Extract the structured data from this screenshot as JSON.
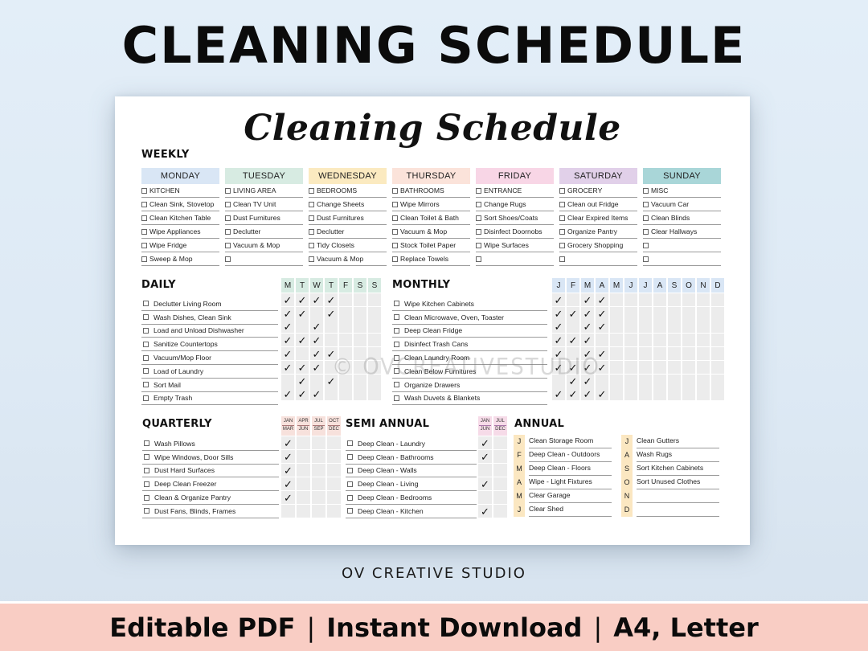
{
  "banner": {
    "title": "CLEANING SCHEDULE"
  },
  "sheet": {
    "title": "Cleaning Schedule",
    "watermark": "© OVCREATIVESTUDIO",
    "weekly": {
      "heading": "WEEKLY",
      "days": [
        {
          "name": "MONDAY",
          "color": "#d9e6f5",
          "tasks": [
            "KITCHEN",
            "Clean Sink, Stovetop",
            "Clean Kitchen Table",
            "Wipe Appliances",
            "Wipe Fridge",
            "Sweep & Mop"
          ]
        },
        {
          "name": "TUESDAY",
          "color": "#d7ebe2",
          "tasks": [
            "LIVING AREA",
            "Clean TV Unit",
            "Dust Furnitures",
            "Declutter",
            "Vacuum & Mop",
            ""
          ]
        },
        {
          "name": "WEDNESDAY",
          "color": "#fbeac0",
          "tasks": [
            "BEDROOMS",
            "Change Sheets",
            "Dust Furnitures",
            "Declutter",
            "Tidy Closets",
            "Vacuum & Mop"
          ]
        },
        {
          "name": "THURSDAY",
          "color": "#fbe3da",
          "tasks": [
            "BATHROOMS",
            "Wipe Mirrors",
            "Clean Toilet & Bath",
            "Vacuum & Mop",
            "Stock Toilet Paper",
            "Replace Towels"
          ]
        },
        {
          "name": "FRIDAY",
          "color": "#f8d6e6",
          "tasks": [
            "ENTRANCE",
            "Change Rugs",
            "Sort Shoes/Coats",
            "Disinfect Doornobs",
            "Wipe Surfaces",
            ""
          ]
        },
        {
          "name": "SATURDAY",
          "color": "#e1d0e9",
          "tasks": [
            "GROCERY",
            "Clean out Fridge",
            "Clear Expired Items",
            "Organize Pantry",
            "Grocery Shopping",
            ""
          ]
        },
        {
          "name": "SUNDAY",
          "color": "#a9d6d8",
          "tasks": [
            "MISC",
            "Vacuum Car",
            "Clean Blinds",
            "Clear Hallways",
            "",
            ""
          ]
        }
      ]
    },
    "daily": {
      "heading": "DAILY",
      "header_color": "#d7ebe2",
      "columns": [
        "M",
        "T",
        "W",
        "T",
        "F",
        "S",
        "S"
      ],
      "check_glyph": "✓",
      "tasks": [
        {
          "label": "Declutter Living Room",
          "checks": [
            1,
            1,
            1,
            1,
            0,
            0,
            0
          ]
        },
        {
          "label": "Wash Dishes, Clean Sink",
          "checks": [
            1,
            1,
            0,
            1,
            0,
            0,
            0
          ]
        },
        {
          "label": "Load and Unload Dishwasher",
          "checks": [
            1,
            0,
            1,
            0,
            0,
            0,
            0
          ]
        },
        {
          "label": "Sanitize Countertops",
          "checks": [
            1,
            1,
            1,
            0,
            0,
            0,
            0
          ]
        },
        {
          "label": "Vacuum/Mop Floor",
          "checks": [
            1,
            0,
            1,
            1,
            0,
            0,
            0
          ]
        },
        {
          "label": "Load of Laundry",
          "checks": [
            1,
            1,
            1,
            0,
            0,
            0,
            0
          ]
        },
        {
          "label": "Sort Mail",
          "checks": [
            0,
            1,
            0,
            1,
            0,
            0,
            0
          ]
        },
        {
          "label": "Empty Trash",
          "checks": [
            1,
            1,
            1,
            0,
            0,
            0,
            0
          ]
        }
      ]
    },
    "monthly": {
      "heading": "MONTHLY",
      "header_color": "#d9e6f5",
      "columns": [
        "J",
        "F",
        "M",
        "A",
        "M",
        "J",
        "J",
        "A",
        "S",
        "O",
        "N",
        "D"
      ],
      "check_glyph": "✓",
      "tasks": [
        {
          "label": "Wipe Kitchen Cabinets",
          "checks": [
            1,
            0,
            1,
            1,
            0,
            0,
            0,
            0,
            0,
            0,
            0,
            0
          ]
        },
        {
          "label": "Clean Microwave, Oven, Toaster",
          "checks": [
            1,
            1,
            1,
            1,
            0,
            0,
            0,
            0,
            0,
            0,
            0,
            0
          ]
        },
        {
          "label": "Deep Clean Fridge",
          "checks": [
            1,
            0,
            1,
            1,
            0,
            0,
            0,
            0,
            0,
            0,
            0,
            0
          ]
        },
        {
          "label": "Disinfect Trash Cans",
          "checks": [
            1,
            1,
            1,
            0,
            0,
            0,
            0,
            0,
            0,
            0,
            0,
            0
          ]
        },
        {
          "label": "Clean Laundry Room",
          "checks": [
            1,
            0,
            1,
            1,
            0,
            0,
            0,
            0,
            0,
            0,
            0,
            0
          ]
        },
        {
          "label": "Clean Below Furnitures",
          "checks": [
            1,
            1,
            1,
            1,
            0,
            0,
            0,
            0,
            0,
            0,
            0,
            0
          ]
        },
        {
          "label": "Organize Drawers",
          "checks": [
            0,
            1,
            1,
            0,
            0,
            0,
            0,
            0,
            0,
            0,
            0,
            0
          ]
        },
        {
          "label": "Wash Duvets & Blankets",
          "checks": [
            1,
            1,
            1,
            1,
            0,
            0,
            0,
            0,
            0,
            0,
            0,
            0
          ]
        }
      ]
    },
    "quarterly": {
      "heading": "QUARTERLY",
      "columns": [
        {
          "top": "JAN",
          "bottom": "MAR"
        },
        {
          "top": "APR",
          "bottom": "JUN"
        },
        {
          "top": "JUL",
          "bottom": "SEP"
        },
        {
          "top": "OCT",
          "bottom": "DEC"
        }
      ],
      "check_glyph": "✓",
      "tasks": [
        {
          "label": "Wash Pillows",
          "checks": [
            1,
            0,
            0,
            0
          ]
        },
        {
          "label": "Wipe Windows, Door Sills",
          "checks": [
            1,
            0,
            0,
            0
          ]
        },
        {
          "label": "Dust Hard Surfaces",
          "checks": [
            1,
            0,
            0,
            0
          ]
        },
        {
          "label": "Deep Clean Freezer",
          "checks": [
            1,
            0,
            0,
            0
          ]
        },
        {
          "label": "Clean & Organize Pantry",
          "checks": [
            1,
            0,
            0,
            0
          ]
        },
        {
          "label": "Dust Fans, Blinds, Frames",
          "checks": [
            0,
            0,
            0,
            0
          ]
        }
      ]
    },
    "semi_annual": {
      "heading": "SEMI ANNUAL",
      "columns": [
        {
          "top": "JAN",
          "bottom": "JUN"
        },
        {
          "top": "JUL",
          "bottom": "DEC"
        }
      ],
      "check_glyph": "✓",
      "tasks": [
        {
          "label": "Deep Clean - Laundry",
          "checks": [
            1,
            0
          ]
        },
        {
          "label": "Deep Clean - Bathrooms",
          "checks": [
            1,
            0
          ]
        },
        {
          "label": "Deep Clean - Walls",
          "checks": [
            0,
            0
          ]
        },
        {
          "label": "Deep Clean - Living",
          "checks": [
            1,
            0
          ]
        },
        {
          "label": "Deep Clean - Bedrooms",
          "checks": [
            0,
            0
          ]
        },
        {
          "label": "Deep Clean - Kitchen",
          "checks": [
            1,
            0
          ]
        }
      ]
    },
    "annual": {
      "heading": "ANNUAL",
      "left": [
        {
          "month": "J",
          "task": "Clean Storage Room"
        },
        {
          "month": "F",
          "task": "Deep Clean - Outdoors"
        },
        {
          "month": "M",
          "task": "Deep Clean - Floors"
        },
        {
          "month": "A",
          "task": "Wipe - Light Fixtures"
        },
        {
          "month": "M",
          "task": "Clear Garage"
        },
        {
          "month": "J",
          "task": "Clear Shed"
        }
      ],
      "right": [
        {
          "month": "J",
          "task": "Clean Gutters"
        },
        {
          "month": "A",
          "task": "Wash Rugs"
        },
        {
          "month": "S",
          "task": "Sort Kitchen Cabinets"
        },
        {
          "month": "O",
          "task": "Sort Unused Clothes"
        },
        {
          "month": "N",
          "task": ""
        },
        {
          "month": "D",
          "task": ""
        }
      ]
    }
  },
  "brand": "OV CREATIVE STUDIO",
  "footer": {
    "items": [
      "Editable PDF",
      "Instant Download",
      "A4, Letter"
    ],
    "separator": "|"
  }
}
